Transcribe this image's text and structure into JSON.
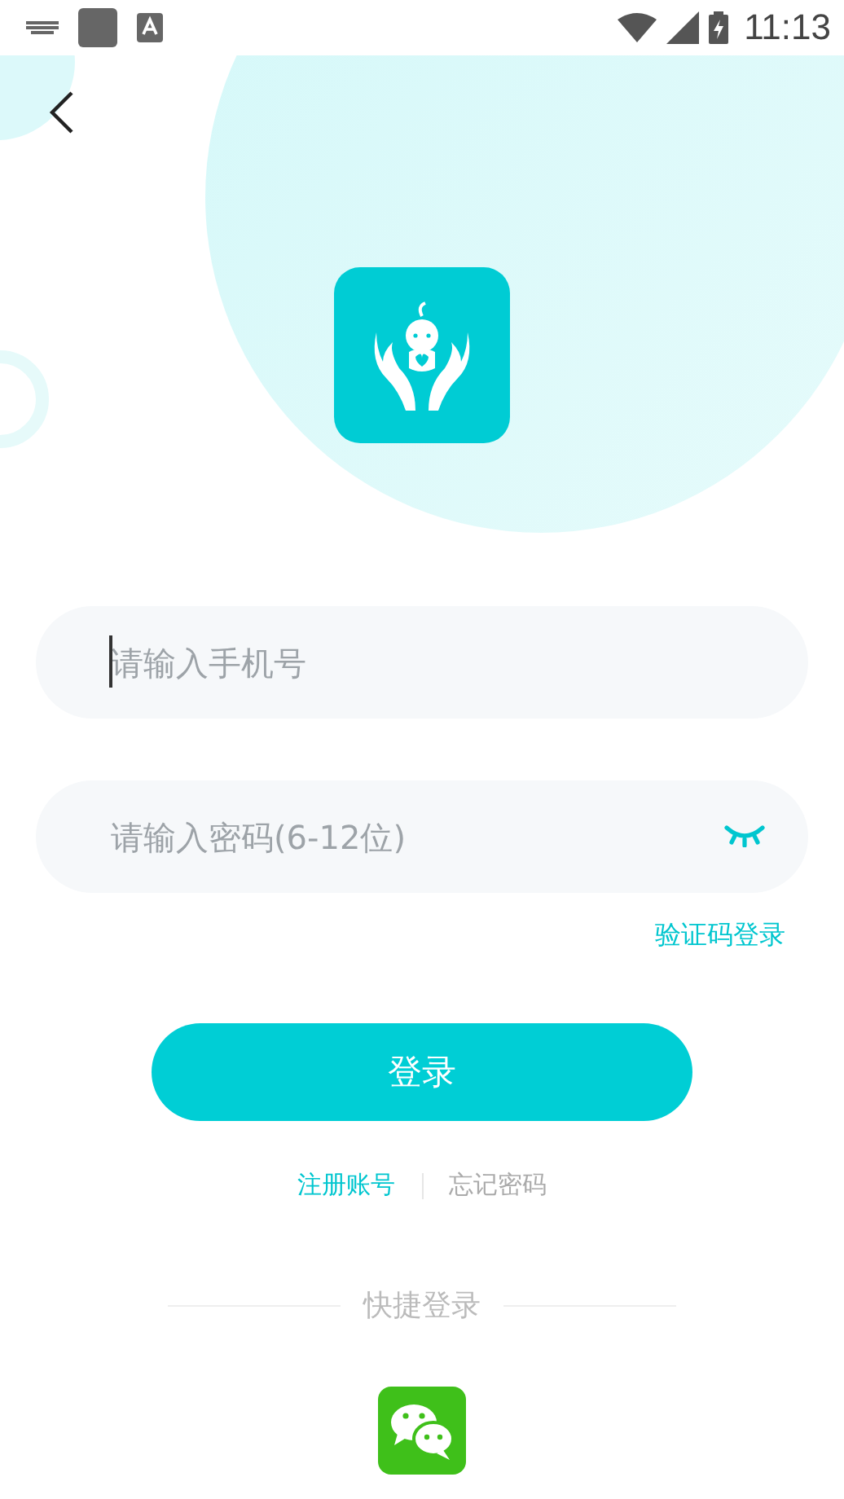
{
  "status_bar": {
    "time": "11:13"
  },
  "phone_field": {
    "placeholder": "请输入手机号",
    "focused": true
  },
  "password_field": {
    "placeholder": "请输入密码(6-12位)"
  },
  "code_login_link": "验证码登录",
  "login_button": "登录",
  "links": [
    {
      "label": "注册账号",
      "kind": "accent"
    },
    {
      "label": "忘记密码",
      "kind": "muted"
    }
  ],
  "quick_login": {
    "title": "快捷登录"
  }
}
